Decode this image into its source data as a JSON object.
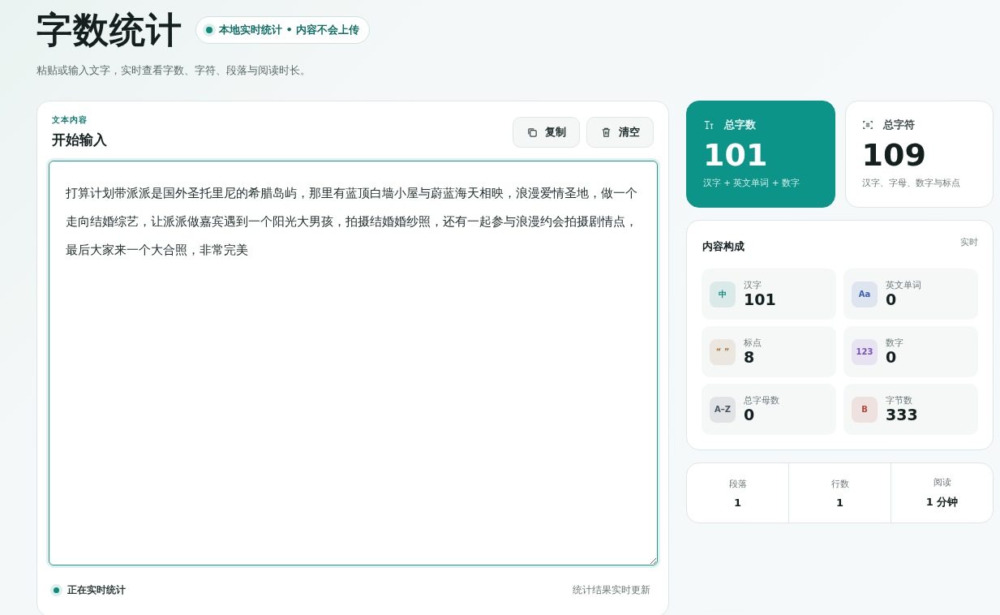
{
  "header": {
    "title": "字数统计",
    "badge": "本地实时统计 • 内容不会上传",
    "subtitle": "粘贴或输入文字，实时查看字数、字符、段落与阅读时长。"
  },
  "editor": {
    "eyebrow": "文本内容",
    "title": "开始输入",
    "buttons": [
      {
        "kind": "copy",
        "label": "复制"
      },
      {
        "kind": "clear",
        "label": "清空"
      }
    ],
    "value": "打算计划带派派是国外圣托里尼的希腊岛屿，那里有蓝顶白墙小屋与蔚蓝海天相映，浪漫爱情圣地，做一个走向结婚综艺，让派派做嘉宾遇到一个阳光大男孩，拍摄结婚婚纱照，还有一起参与浪漫约会拍摄剧情点，最后大家来一个大合照，非常完美",
    "status": "正在实时统计",
    "note": "统计结果实时更新"
  },
  "stats": [
    {
      "kind": "words",
      "label": "总字数",
      "value": "101",
      "caption": "汉字 + 英文单词 + 数字",
      "selected": true
    },
    {
      "kind": "chars",
      "label": "总字符",
      "value": "109",
      "caption": "汉字、字母、数字与标点",
      "selected": false
    }
  ],
  "composition": {
    "title": "内容构成",
    "tag": "实时",
    "items": [
      {
        "badge": "中",
        "label": "汉字",
        "value": "101",
        "color": "#0f8a7e"
      },
      {
        "badge": "Aa",
        "label": "英文单词",
        "value": "0",
        "color": "#3b5fb0"
      },
      {
        "badge": "“ ”",
        "label": "标点",
        "value": "8",
        "color": "#a0763a"
      },
      {
        "badge": "123",
        "label": "数字",
        "value": "0",
        "color": "#7a4fc0"
      },
      {
        "badge": "A–Z",
        "label": "总字母数",
        "value": "0",
        "color": "#4a5563"
      },
      {
        "badge": "B",
        "label": "字节数",
        "value": "333",
        "color": "#b0473a"
      }
    ]
  },
  "summary": [
    {
      "label": "段落",
      "value": "1"
    },
    {
      "label": "行数",
      "value": "1"
    },
    {
      "label": "阅读",
      "value": "1 分钟"
    }
  ]
}
